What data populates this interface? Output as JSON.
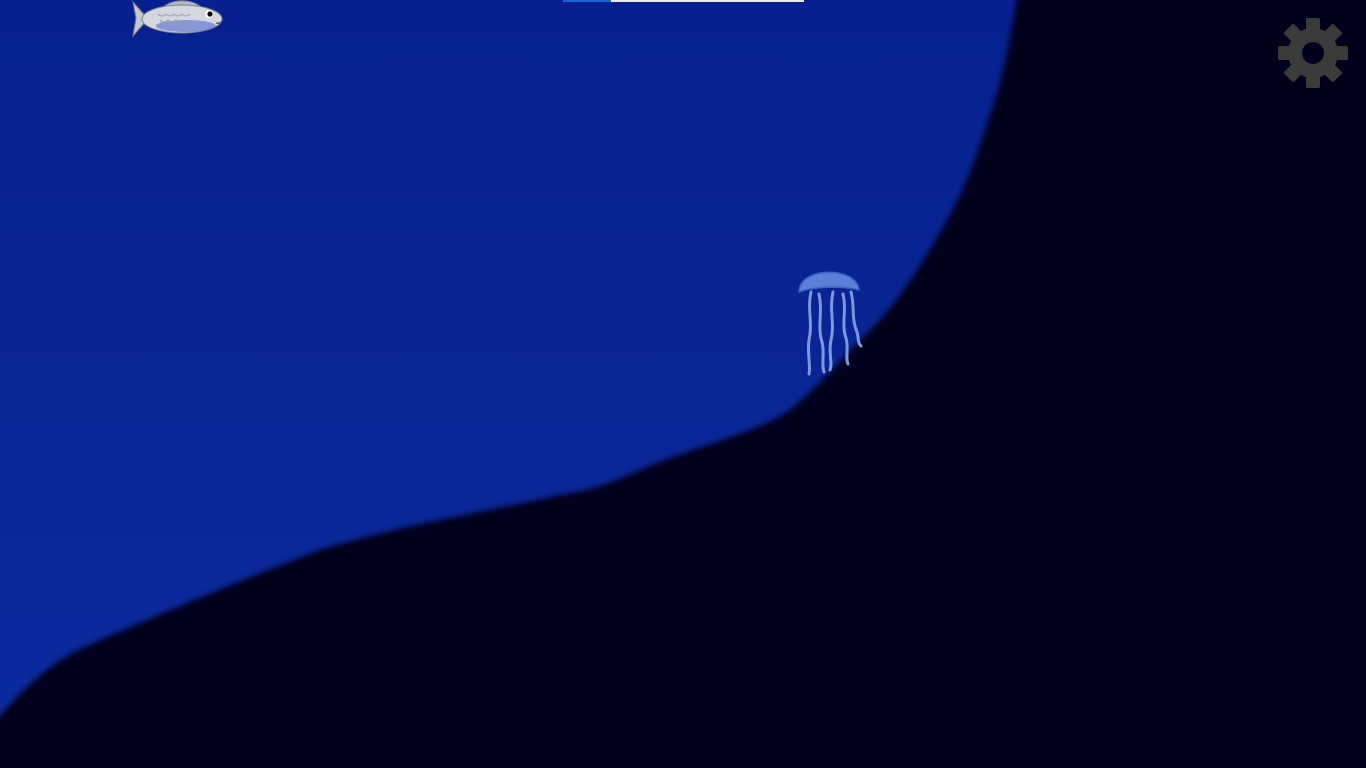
{
  "hud": {
    "progress": 0.2,
    "settings_icon": "gear-icon"
  },
  "colors": {
    "water_top": "#06208f",
    "water_bottom": "#0b2aa0",
    "seabed": "#00001e",
    "gear": "#3a3a3a",
    "progress_fill": "#1a64d8",
    "progress_track": "#e8ecf8"
  },
  "sprites": {
    "fish": "fish-sprite",
    "jellyfish": "jellyfish-sprite"
  }
}
